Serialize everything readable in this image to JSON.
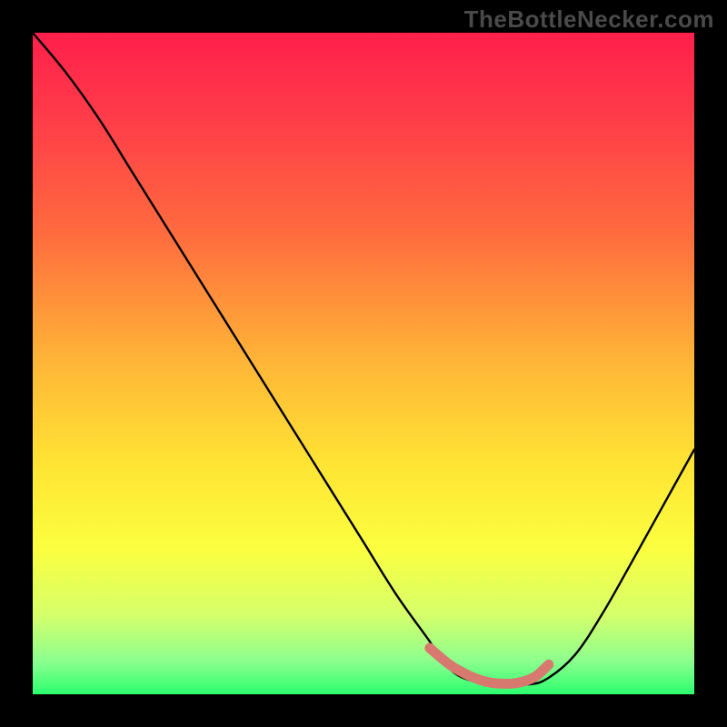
{
  "watermark": "TheBottleNecker.com",
  "chart_data": {
    "type": "line",
    "title": "",
    "xlabel": "",
    "ylabel": "",
    "xlim": [
      0,
      100
    ],
    "ylim": [
      0,
      100
    ],
    "grid": false,
    "legend": false,
    "gradient_stops": [
      {
        "offset": 0.0,
        "color": "#ff1f4b"
      },
      {
        "offset": 0.12,
        "color": "#ff3a49"
      },
      {
        "offset": 0.3,
        "color": "#ff6a3f"
      },
      {
        "offset": 0.5,
        "color": "#ffb637"
      },
      {
        "offset": 0.65,
        "color": "#ffe334"
      },
      {
        "offset": 0.78,
        "color": "#fbff3f"
      },
      {
        "offset": 0.88,
        "color": "#d6ff6b"
      },
      {
        "offset": 0.95,
        "color": "#8cff8e"
      },
      {
        "offset": 1.0,
        "color": "#2bff6f"
      }
    ],
    "curve": {
      "x": [
        0,
        5,
        10,
        15,
        20,
        25,
        30,
        35,
        40,
        45,
        50,
        55,
        60,
        62,
        65,
        70,
        75,
        78,
        82,
        86,
        90,
        95,
        100
      ],
      "y": [
        100,
        94,
        87,
        79,
        71,
        63,
        55,
        47,
        39,
        31,
        23,
        15,
        8,
        5,
        2.5,
        1.5,
        1.5,
        2.5,
        6,
        12,
        19,
        28,
        37
      ]
    },
    "highlight": {
      "color": "#d8796f",
      "x": [
        60,
        63,
        66,
        69,
        72,
        74,
        76,
        78
      ],
      "y": [
        7,
        4.5,
        2.8,
        1.8,
        1.6,
        1.9,
        2.7,
        4.5
      ]
    }
  }
}
